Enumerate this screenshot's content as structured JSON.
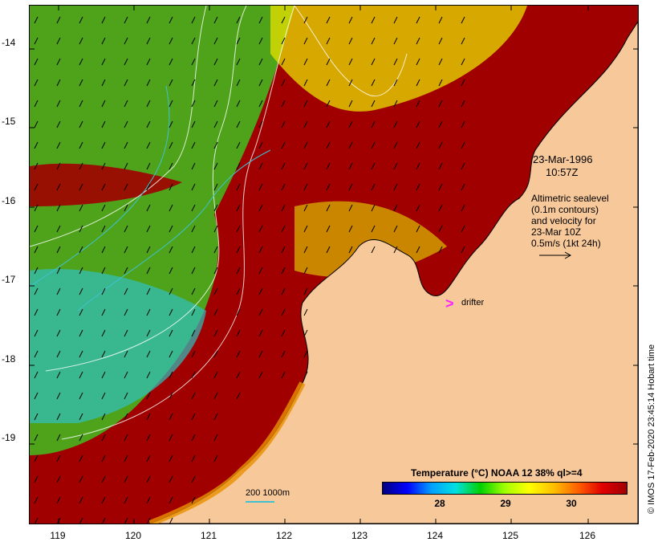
{
  "map": {
    "y_ticks": [
      "-14",
      "-15",
      "-16",
      "-17",
      "-18",
      "-19"
    ],
    "x_ticks": [
      "119",
      "120",
      "121",
      "122",
      "123",
      "124",
      "125",
      "126"
    ],
    "lat_range": [
      -20.05,
      -13.5
    ],
    "lon_range": [
      118.65,
      126.7
    ]
  },
  "annotations": {
    "date": "23-Mar-1996",
    "time": "10:57Z",
    "altimetric_lines": [
      "Altimetric sealevel",
      "(0.1m contours)",
      "and velocity for",
      "23-Mar 10Z",
      "0.5m/s (1kt 24h)"
    ],
    "drifter_symbol": ">",
    "drifter_label": "drifter",
    "scale_label": "200  1000m"
  },
  "colorbar": {
    "title": "Temperature (°C) NOAA 12 38% ql>=4",
    "ticks": [
      "28",
      "29",
      "30"
    ],
    "range": [
      27.2,
      30.8
    ]
  },
  "credit": "© IMOS 17-Feb-2020 23:45:14 Hobart time",
  "colors": {
    "land": "#f7c89a",
    "warm": "#a00000",
    "orange": "#e89000",
    "yellow": "#e8e000",
    "green": "#40c020",
    "cyan": "#30c0c0",
    "drifter": "#ff22ff"
  }
}
